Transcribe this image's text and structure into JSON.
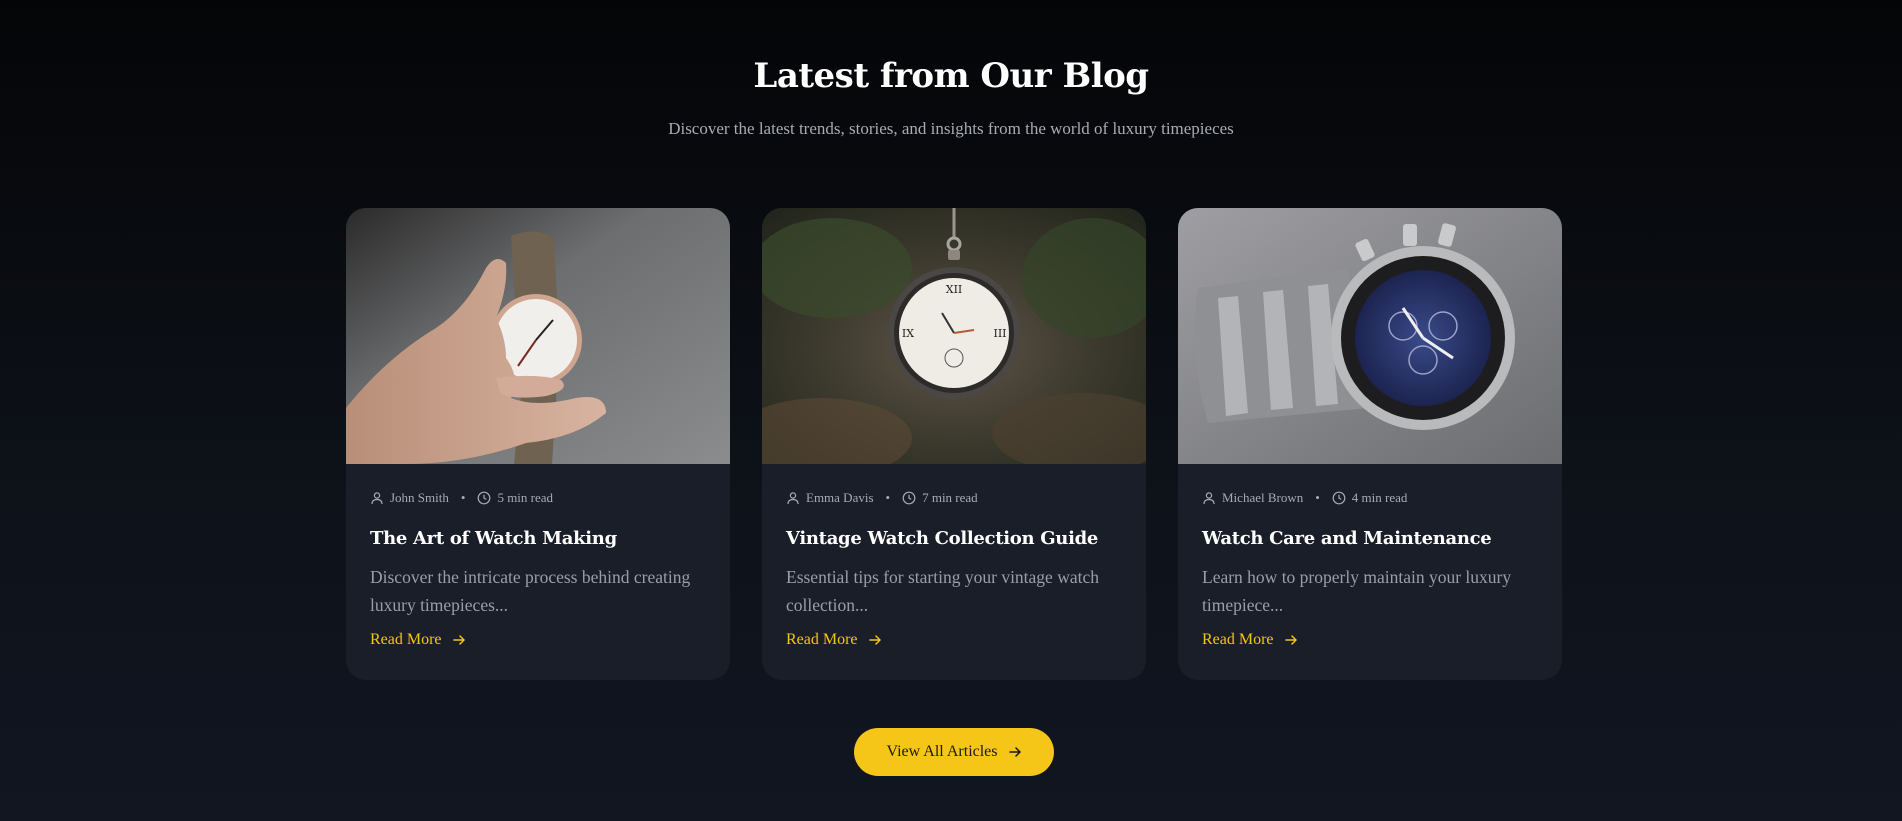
{
  "section": {
    "title": "Latest from Our Blog",
    "subtitle": "Discover the latest trends, stories, and insights from the world of luxury timepieces"
  },
  "posts": [
    {
      "author": "John Smith",
      "read_time": "5 min read",
      "title": "The Art of Watch Making",
      "description": "Discover the intricate process behind creating luxury timepieces...",
      "cta": "Read More",
      "image": "hand-holding-watch"
    },
    {
      "author": "Emma Davis",
      "read_time": "7 min read",
      "title": "Vintage Watch Collection Guide",
      "description": "Essential tips for starting your vintage watch collection...",
      "cta": "Read More",
      "image": "pocket-watch"
    },
    {
      "author": "Michael Brown",
      "read_time": "4 min read",
      "title": "Watch Care and Maintenance",
      "description": "Learn how to properly maintain your luxury timepiece...",
      "cta": "Read More",
      "image": "chronograph-watch"
    }
  ],
  "footer": {
    "view_all_label": "View All Articles"
  },
  "colors": {
    "accent": "#f5c518",
    "card_bg": "#1a1e28",
    "muted_text": "#a7abb3"
  },
  "icons": {
    "author": "user-icon",
    "read_time": "clock-icon",
    "arrow": "arrow-right-icon"
  }
}
